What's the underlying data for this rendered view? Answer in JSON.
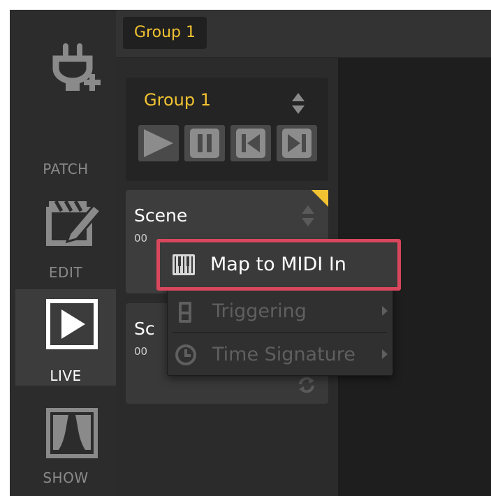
{
  "sidebar": {
    "modes": [
      {
        "label": "PATCH",
        "icon": "patch-plug-icon"
      },
      {
        "label": "EDIT",
        "icon": "edit-clapperboard-icon"
      },
      {
        "label": "LIVE",
        "icon": "live-play-icon",
        "active": true
      },
      {
        "label": "SHOW",
        "icon": "show-curtain-icon"
      }
    ]
  },
  "tabbar": {
    "group_tab": "Group 1"
  },
  "group_panel": {
    "title": "Group 1",
    "controls": [
      "play",
      "pause",
      "previous",
      "next"
    ]
  },
  "scenes": [
    {
      "title": "Scene",
      "subtitle": "00"
    },
    {
      "title": "Sc",
      "subtitle": "00"
    }
  ],
  "context_menu": {
    "items": [
      {
        "label": "Map to MIDI In",
        "icon": "piano-keys-icon",
        "highlighted": true
      },
      {
        "label": "Triggering",
        "icon": "trigger-icon",
        "submenu": true
      },
      {
        "label": "Time Signature",
        "icon": "clock-icon",
        "submenu": true
      }
    ]
  },
  "colors": {
    "accent": "#f1c232",
    "highlight_border": "#d9475d",
    "background": "#2b2b2b"
  }
}
